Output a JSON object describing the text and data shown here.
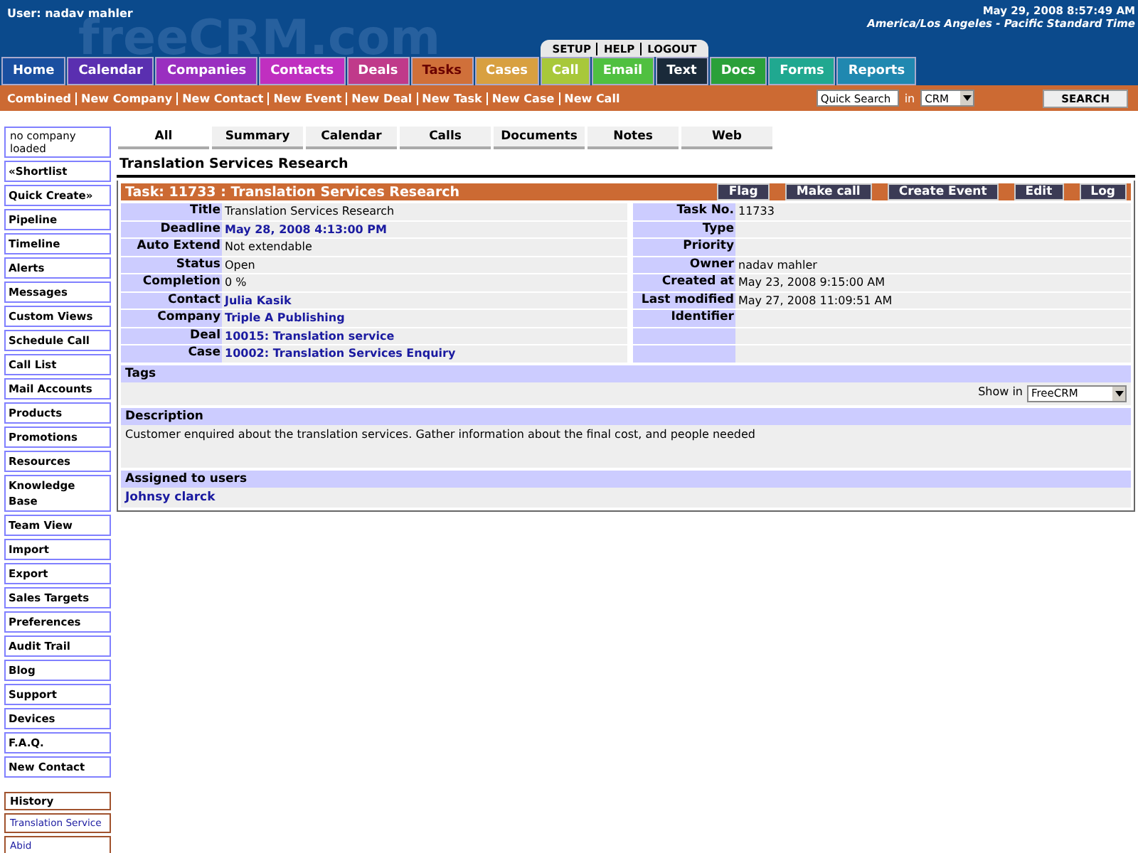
{
  "header": {
    "user": "User: nadav mahler",
    "logo": "freeCRM.com",
    "date": "May 29, 2008 8:57:49 AM",
    "timezone": "America/Los Angeles - Pacific Standard Time",
    "top_links": [
      "SETUP",
      "HELP",
      "LOGOUT"
    ]
  },
  "nav_tabs": [
    {
      "label": "Home",
      "color": "#1a4fa0",
      "selected": false
    },
    {
      "label": "Calendar",
      "color": "#5a2fb0",
      "selected": false
    },
    {
      "label": "Companies",
      "color": "#9a2fc0",
      "selected": false
    },
    {
      "label": "Contacts",
      "color": "#c02fc0",
      "selected": false
    },
    {
      "label": "Deals",
      "color": "#c03a8a",
      "selected": false
    },
    {
      "label": "Tasks",
      "color": "#d0703a",
      "selected": true
    },
    {
      "label": "Cases",
      "color": "#d8a040",
      "selected": false
    },
    {
      "label": "Call",
      "color": "#a8c83a",
      "selected": false
    },
    {
      "label": "Email",
      "color": "#50c040",
      "selected": false
    },
    {
      "label": "Text",
      "color": "#1a2a3a",
      "selected": false
    },
    {
      "label": "Docs",
      "color": "#2aa03a",
      "selected": false
    },
    {
      "label": "Forms",
      "color": "#20a890",
      "selected": false
    },
    {
      "label": "Reports",
      "color": "#2088b0",
      "selected": false
    }
  ],
  "quick_links": [
    "Combined",
    "New Company",
    "New Contact",
    "New Event",
    "New Deal",
    "New Task",
    "New Case",
    "New Call"
  ],
  "search": {
    "placeholder": "Quick Search",
    "in_label": "in",
    "scope": "CRM",
    "button": "SEARCH"
  },
  "sidebar": {
    "company_note": "no company loaded",
    "items": [
      "«Shortlist",
      "Quick Create»",
      "Pipeline",
      "Timeline",
      "Alerts",
      "Messages",
      "Custom Views",
      "Schedule Call",
      "Call List",
      "Mail Accounts",
      "Products",
      "Promotions",
      "Resources",
      "Knowledge Base",
      "Team View",
      "Import",
      "Export",
      "Sales Targets",
      "Preferences",
      "Audit Trail",
      "Blog",
      "Support",
      "Devices",
      "F.A.Q.",
      "New Contact"
    ],
    "history_title": "History",
    "history": [
      "Translation Service",
      "Abid"
    ]
  },
  "sub_tabs": [
    {
      "label": "All",
      "selected": true
    },
    {
      "label": "Summary",
      "selected": false
    },
    {
      "label": "Calendar",
      "selected": false
    },
    {
      "label": "Calls",
      "selected": false
    },
    {
      "label": "Documents",
      "selected": false
    },
    {
      "label": "Notes",
      "selected": false
    },
    {
      "label": "Web",
      "selected": false
    }
  ],
  "page_title": "Translation Services Research",
  "task": {
    "heading": "Task: 11733 : Translation Services Research",
    "actions": [
      "Flag",
      "Make call",
      "Create Event",
      "Edit",
      "Log"
    ],
    "left_fields": [
      {
        "label": "Title",
        "value": "Translation Services Research",
        "kind": "text"
      },
      {
        "label": "Deadline",
        "value": "May 28, 2008 4:13:00 PM",
        "kind": "link"
      },
      {
        "label": "Auto Extend",
        "value": "Not extendable",
        "kind": "text"
      },
      {
        "label": "Status",
        "value": "Open",
        "kind": "text"
      },
      {
        "label": "Completion",
        "value": "0 %",
        "kind": "text"
      },
      {
        "label": "Contact",
        "value": "Julia Kasik",
        "kind": "link"
      },
      {
        "label": "Company",
        "value": "Triple A Publishing",
        "kind": "link"
      },
      {
        "label": "Deal",
        "value": "10015: Translation service",
        "kind": "link"
      },
      {
        "label": "Case",
        "value": "10002: Translation Services Enquiry",
        "kind": "link"
      }
    ],
    "right_fields": [
      {
        "label": "Task No.",
        "value": "11733"
      },
      {
        "label": "Type"
      },
      {
        "label": "Priority"
      },
      {
        "label": "Owner",
        "value": "nadav mahler"
      },
      {
        "label": "Created at",
        "value": "May 23, 2008 9:15:00 AM"
      },
      {
        "label": "Last modified",
        "value": "May 27, 2008 11:09:51 AM"
      },
      {
        "label": "Identifier"
      }
    ],
    "tags_title": "Tags",
    "show_in_label": "Show in",
    "show_in_value": "FreeCRM",
    "description_title": "Description",
    "description": "Customer enquired about the translation services. Gather information about the final cost, and people needed",
    "assigned_title": "Assigned to users",
    "assigned": [
      "Johnsy clarck"
    ]
  }
}
